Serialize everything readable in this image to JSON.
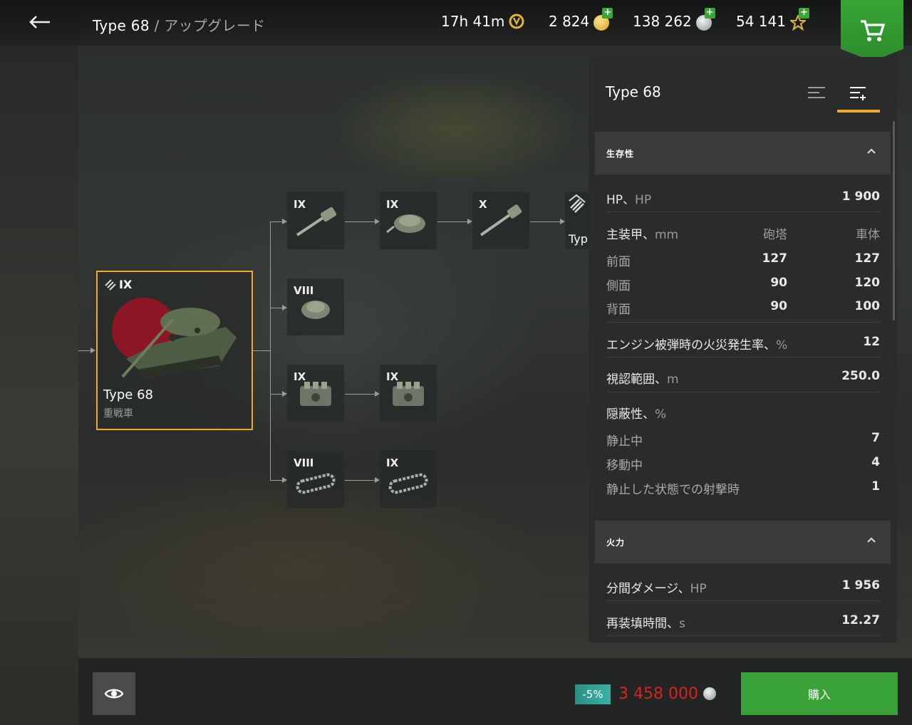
{
  "header": {
    "back_icon": "back-arrow-icon",
    "title": "Type 68",
    "separator": " / ",
    "subtitle": "アップグレード",
    "timer": "17h 41m",
    "gold": "2 824",
    "credits": "138 262",
    "free_xp": "54 141",
    "plus": "+"
  },
  "tree": {
    "main_tank": {
      "tier": "IX",
      "name": "Type 68",
      "class": "重戦車"
    },
    "nodes": [
      {
        "tier": "IX",
        "icon": "gun-icon"
      },
      {
        "tier": "IX",
        "icon": "turret-icon"
      },
      {
        "tier": "X",
        "icon": "gun-icon"
      },
      {
        "tier": "VIII",
        "icon": "turret-icon"
      },
      {
        "tier": "IX",
        "icon": "engine-icon"
      },
      {
        "tier": "IX",
        "icon": "engine-icon"
      },
      {
        "tier": "VIII",
        "icon": "tracks-icon"
      },
      {
        "tier": "IX",
        "icon": "tracks-icon"
      }
    ],
    "next_tank_label": "Typ"
  },
  "panel": {
    "title": "Type 68",
    "survivability": {
      "header": "生存性",
      "hp": {
        "label": "HP、",
        "unit": "HP",
        "value": "1 900"
      },
      "armor": {
        "label": "主装甲、",
        "unit": "mm",
        "col1": "砲塔",
        "col2": "車体"
      },
      "armor_rows": [
        {
          "label": "前面",
          "turret": "127",
          "hull": "127"
        },
        {
          "label": "側面",
          "turret": "90",
          "hull": "120"
        },
        {
          "label": "背面",
          "turret": "90",
          "hull": "100"
        }
      ],
      "fire": {
        "label": "エンジン被弾時の火災発生率、",
        "unit": "%",
        "value": "12"
      },
      "view": {
        "label": "視認範囲、",
        "unit": "m",
        "value": "250.0"
      },
      "camo": {
        "label": "隠蔽性、",
        "unit": "%"
      },
      "camo_rows": [
        {
          "label": "静止中",
          "value": "7"
        },
        {
          "label": "移動中",
          "value": "4"
        },
        {
          "label": "静止した状態での射撃時",
          "value": "1"
        }
      ]
    },
    "firepower": {
      "header": "火力",
      "dpm": {
        "label": "分間ダメージ、",
        "unit": "HP",
        "value": "1 956"
      },
      "reload": {
        "label": "再装填時間、",
        "unit": "s",
        "value": "12.27"
      }
    }
  },
  "footer": {
    "discount": "-5%",
    "price": "3 458 000",
    "buy": "購入"
  },
  "colors": {
    "accent": "#f1a82b",
    "buy": "#39a238",
    "price": "#d8241c"
  }
}
